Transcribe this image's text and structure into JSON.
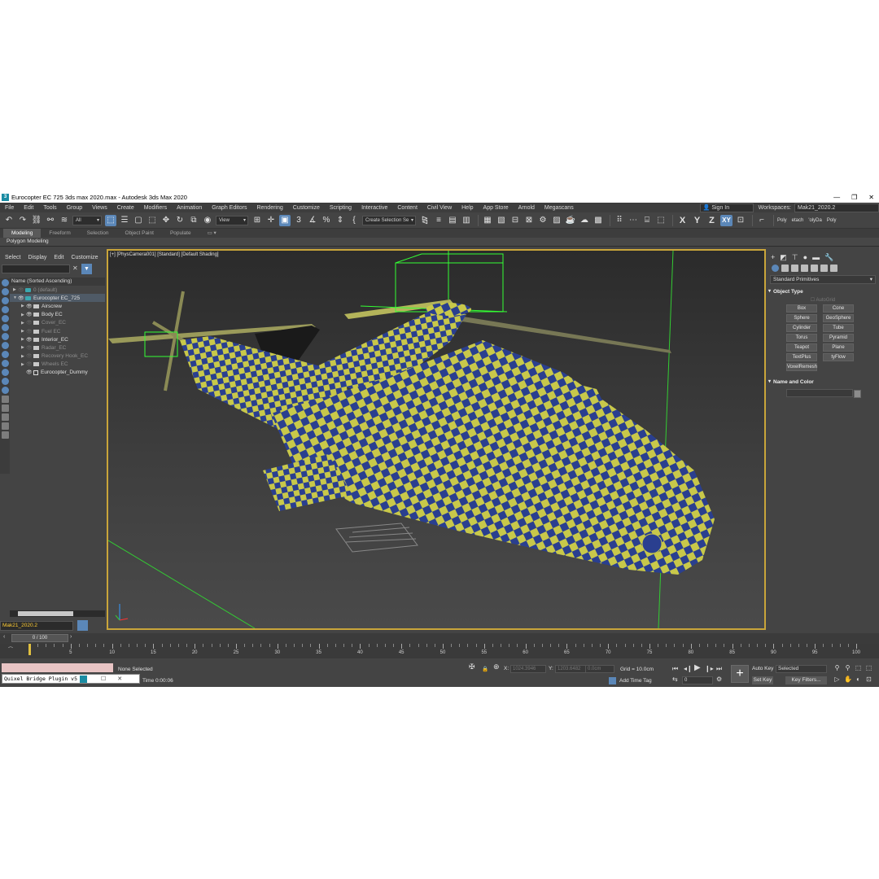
{
  "window": {
    "title": "Eurocopter EC 725 3ds max 2020.max - Autodesk 3ds Max 2020",
    "app_icon": "3ds-max-logo-icon",
    "controls": [
      "—",
      "❐",
      "✕"
    ]
  },
  "menu": {
    "items": [
      "File",
      "Edit",
      "Tools",
      "Group",
      "Views",
      "Create",
      "Modifiers",
      "Animation",
      "Graph Editors",
      "Rendering",
      "Customize",
      "Scripting",
      "Interactive",
      "Content",
      "Civil View",
      "Help",
      "App Store",
      "Arnold",
      "Megascans"
    ],
    "sign_in": "Sign In",
    "workspaces_label": "Workspaces:",
    "workspace_value": "Mak21_2020.2"
  },
  "toolbar": {
    "selection_filter": "All",
    "ref_coord": "View",
    "named_selection": "Create Selection Se",
    "axes": [
      "X",
      "Y",
      "Z",
      "XY"
    ],
    "right_labels": [
      "Poly",
      "etach",
      "'olyDa",
      "Poly"
    ]
  },
  "ribbon": {
    "tabs": [
      "Modeling",
      "Freeform",
      "Selection",
      "Object Paint",
      "Populate"
    ],
    "panel": "Polygon Modeling"
  },
  "explorer": {
    "menu": [
      "Select",
      "Display",
      "Edit",
      "Customize"
    ],
    "header": "Name (Sorted Ascending)",
    "rows": [
      {
        "label": "0 (default)",
        "indent": 0,
        "dim": true,
        "type": "layer",
        "eye": false
      },
      {
        "label": "Eurocopter EC_725",
        "indent": 0,
        "dim": false,
        "type": "layer",
        "eye": true,
        "selected": true
      },
      {
        "label": "Airscrew",
        "indent": 1,
        "dim": false,
        "type": "object",
        "eye": true
      },
      {
        "label": "Body EC",
        "indent": 1,
        "dim": false,
        "type": "object",
        "eye": true
      },
      {
        "label": "Cover_EC",
        "indent": 1,
        "dim": true,
        "type": "object",
        "eye": false
      },
      {
        "label": "Fuel EC",
        "indent": 1,
        "dim": true,
        "type": "object",
        "eye": false
      },
      {
        "label": "Interior_EC",
        "indent": 1,
        "dim": false,
        "type": "object",
        "eye": true
      },
      {
        "label": "Radar_EC",
        "indent": 1,
        "dim": true,
        "type": "object",
        "eye": false
      },
      {
        "label": "Recovery Hook_EC",
        "indent": 1,
        "dim": true,
        "type": "object",
        "eye": false
      },
      {
        "label": "Wheels EC",
        "indent": 1,
        "dim": true,
        "type": "object",
        "eye": false
      },
      {
        "label": "Eurocopter_Dummy",
        "indent": 1,
        "dim": false,
        "type": "dummy",
        "eye": true
      }
    ],
    "layer_dropdown": "Mak21_2020.2"
  },
  "viewport": {
    "label": "[+] [PhysCamera001] [Standard] [Default Shading]",
    "checker_colors": {
      "yellow": "#c8c84a",
      "blue": "#2a3f8f",
      "grid_green": "#33cc33",
      "border": "#c9a53a"
    }
  },
  "command_panel": {
    "category": "Standard Primitives",
    "object_type_title": "Object Type",
    "autogrid": "AutoGrid",
    "primitives": [
      "Box",
      "Cone",
      "Sphere",
      "GeoSphere",
      "Cylinder",
      "Tube",
      "Torus",
      "Pyramid",
      "Teapot",
      "Plane",
      "TextPlus",
      "tyFlow"
    ],
    "extra_primitive": "VoxelRemesh",
    "name_color_title": "Name and Color"
  },
  "timeline": {
    "frame_box": "0 / 100",
    "ticks": [
      0,
      5,
      10,
      15,
      20,
      25,
      30,
      35,
      40,
      45,
      50,
      55,
      60,
      65,
      70,
      75,
      80,
      85,
      90,
      95,
      100
    ],
    "labels": [
      "5",
      "10",
      "15",
      "20",
      "25",
      "30",
      "35",
      "40",
      "45",
      "50",
      "55",
      "60",
      "65",
      "70",
      "75",
      "80",
      "85",
      "90",
      "95",
      "100"
    ],
    "current_frame": 0
  },
  "status": {
    "maxscript": "Quixel Bridge Plugin v5",
    "selection": "None Selected",
    "time": "Time  0:00:06",
    "x_label": "X:",
    "x_value": "1024.3946",
    "y_label": "Y:",
    "y_value": "1203.6482",
    "z_label": "Z:",
    "z_value": "0.0cm",
    "grid": "Grid = 10.0cm",
    "add_time_tag": "Add Time Tag",
    "frame_value": "0",
    "auto_key": "Auto Key",
    "set_key": "Set Key",
    "selected_dd": "Selected",
    "key_filters": "Key Filters..."
  }
}
